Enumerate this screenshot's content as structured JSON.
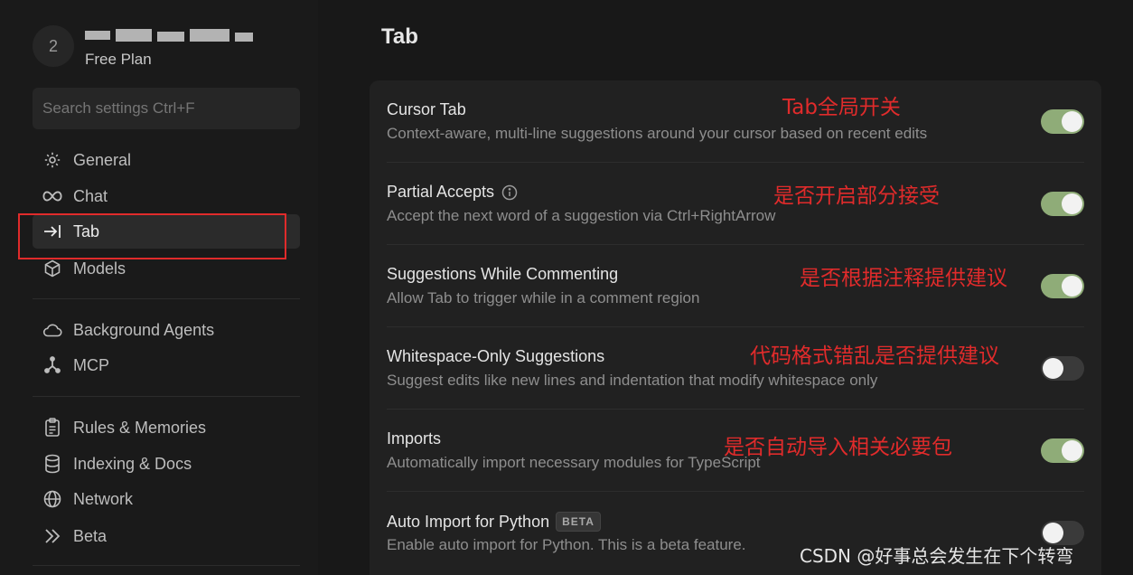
{
  "profile": {
    "avatar_initial": "2",
    "plan": "Free Plan"
  },
  "search": {
    "placeholder": "Search settings Ctrl+F"
  },
  "sidebar": {
    "items": [
      {
        "label": "General",
        "icon": "gear-icon"
      },
      {
        "label": "Chat",
        "icon": "infinity-icon"
      },
      {
        "label": "Tab",
        "icon": "arrow-to-line-icon",
        "active": true
      },
      {
        "label": "Models",
        "icon": "cube-icon"
      },
      {
        "label": "Background Agents",
        "icon": "cloud-icon"
      },
      {
        "label": "MCP",
        "icon": "network-nodes-icon"
      },
      {
        "label": "Rules & Memories",
        "icon": "clipboard-icon"
      },
      {
        "label": "Indexing & Docs",
        "icon": "database-icon"
      },
      {
        "label": "Network",
        "icon": "globe-icon"
      },
      {
        "label": "Beta",
        "icon": "double-chevron-right-icon"
      }
    ]
  },
  "main": {
    "title": "Tab",
    "settings": [
      {
        "title": "Cursor Tab",
        "description": "Context-aware, multi-line suggestions around your cursor based on recent edits",
        "enabled": true,
        "annotation": "Tab全局开关"
      },
      {
        "title": "Partial Accepts",
        "description": "Accept the next word of a suggestion via Ctrl+RightArrow",
        "enabled": true,
        "annotation": "是否开启部分接受"
      },
      {
        "title": "Suggestions While Commenting",
        "description": "Allow Tab to trigger while in a comment region",
        "enabled": true,
        "annotation": "是否根据注释提供建议"
      },
      {
        "title": "Whitespace-Only Suggestions",
        "description": "Suggest edits like new lines and indentation that modify whitespace only",
        "enabled": false,
        "annotation": "代码格式错乱是否提供建议"
      },
      {
        "title": "Imports",
        "description": "Automatically import necessary modules for TypeScript",
        "enabled": true,
        "annotation": "是否自动导入相关必要包"
      },
      {
        "title": "Auto Import for Python",
        "badge": "BETA",
        "description": "Enable auto import for Python. This is a beta feature.",
        "enabled": false
      }
    ]
  },
  "watermark": "CSDN @好事总会发生在下个转弯",
  "colors": {
    "toggle_on": "#8fac78",
    "annotation": "#e02b2b",
    "background": "#181818"
  }
}
